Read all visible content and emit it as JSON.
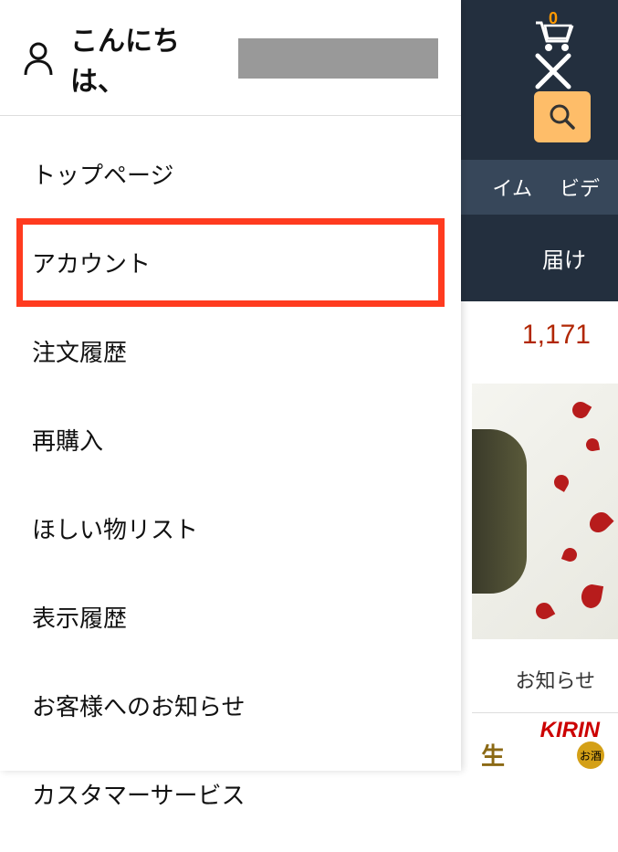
{
  "drawer": {
    "greeting_prefix": "こんにちは、",
    "items": [
      {
        "label": "トップページ",
        "highlighted": false
      },
      {
        "label": "アカウント",
        "highlighted": true
      },
      {
        "label": "注文履歴",
        "highlighted": false
      },
      {
        "label": "再購入",
        "highlighted": false
      },
      {
        "label": "ほしい物リスト",
        "highlighted": false
      },
      {
        "label": "表示履歴",
        "highlighted": false
      },
      {
        "label": "お客様へのお知らせ",
        "highlighted": false
      },
      {
        "label": "カスタマーサービス",
        "highlighted": false
      }
    ]
  },
  "background": {
    "cart_count": "0",
    "nav_items": [
      "イム",
      "ビデ"
    ],
    "subnav_text": "届け",
    "price": "1,171",
    "notice_text": "お知らせ",
    "ad": {
      "brand": "KIRIN",
      "main_text": "生",
      "badge": "お酒"
    }
  }
}
